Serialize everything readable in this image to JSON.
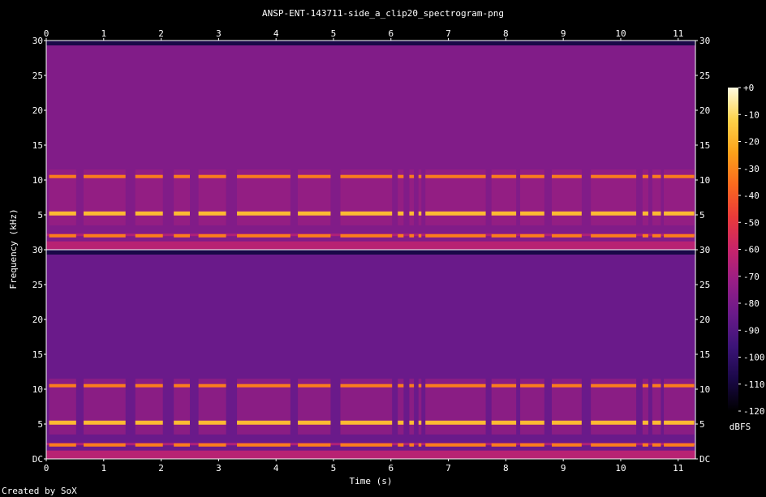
{
  "chart_data": {
    "type": "heatmap",
    "title": "ANSP-ENT-143711-side_a_clip20_spectrogram-png",
    "xlabel": "Time (s)",
    "ylabel": "Frequency (kHz)",
    "xlim": [
      0,
      11.3
    ],
    "ylim": [
      0,
      30
    ],
    "x_ticks": [
      "0",
      "1",
      "2",
      "3",
      "4",
      "5",
      "6",
      "7",
      "8",
      "9",
      "10",
      "11"
    ],
    "y_ticks": [
      {
        "value": 0,
        "label": "DC"
      },
      {
        "value": 5,
        "label": "5"
      },
      {
        "value": 10,
        "label": "10"
      },
      {
        "value": 15,
        "label": "15"
      },
      {
        "value": 20,
        "label": "20"
      },
      {
        "value": 25,
        "label": "25"
      },
      {
        "value": 30,
        "label": "30"
      }
    ],
    "colorbar": {
      "label": "dBFS",
      "range": [
        -120,
        0
      ],
      "ticks": [
        "+0",
        "-10",
        "-20",
        "-30",
        "-40",
        "-50",
        "-60",
        "-70",
        "-80",
        "-90",
        "-100",
        "-110",
        "-120"
      ],
      "colors": [
        "#000000",
        "#1a0848",
        "#3c1478",
        "#6a1a8a",
        "#981e86",
        "#c8246a",
        "#ea3a3a",
        "#fb6a1e",
        "#fca21a",
        "#fdd24a",
        "#fffbe0"
      ]
    },
    "channels": 2,
    "harmonic_bands_khz": [
      2,
      5.2,
      10.5
    ],
    "pulse_segments_s": [
      [
        0.05,
        0.52
      ],
      [
        0.65,
        1.38
      ],
      [
        1.55,
        2.03
      ],
      [
        2.22,
        2.5
      ],
      [
        2.65,
        3.13
      ],
      [
        3.32,
        4.25
      ],
      [
        4.38,
        4.95
      ],
      [
        5.12,
        6.02
      ],
      [
        6.12,
        6.22
      ],
      [
        6.32,
        6.4
      ],
      [
        6.48,
        6.53
      ],
      [
        6.6,
        7.65
      ],
      [
        7.75,
        8.18
      ],
      [
        8.25,
        8.67
      ],
      [
        8.8,
        9.32
      ],
      [
        9.48,
        10.27
      ],
      [
        10.38,
        10.48
      ],
      [
        10.55,
        10.7
      ],
      [
        10.75,
        11.28
      ]
    ],
    "background_dbfs": -78,
    "band_dbfs": -22
  },
  "footer": "Created by SoX"
}
